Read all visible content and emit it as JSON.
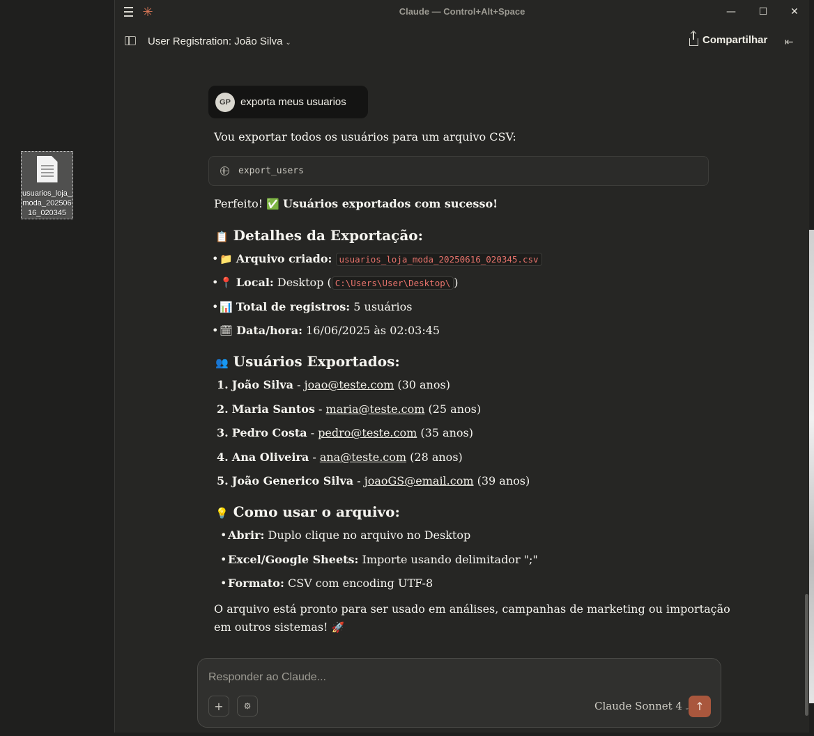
{
  "window": {
    "title": "Claude — Control+Alt+Space"
  },
  "desktop": {
    "file_name": "usuarios_loja_moda_20250616_020345"
  },
  "header": {
    "conversation_title": "User Registration: João Silva",
    "share_label": "Compartilhar"
  },
  "user_message": {
    "avatar_initials": "GP",
    "text": "exporta meus usuarios"
  },
  "assistant": {
    "intro": "Vou exportar todos os usuários para um arquivo CSV:",
    "tool_call": "export_users",
    "success_prefix": "Perfeito! ",
    "success_emoji": "✅",
    "success_text": "Usuários exportados com sucesso!",
    "details_heading": {
      "emoji": "📋",
      "text": "Detalhes da Exportação:"
    },
    "details": [
      {
        "emoji": "📁",
        "label": "Arquivo criado:",
        "code": "usuarios_loja_moda_20250616_020345.csv"
      },
      {
        "emoji": "📍",
        "label": "Local:",
        "text_before": " Desktop (",
        "code": "C:\\Users\\User\\Desktop\\",
        "text_after": ")"
      },
      {
        "emoji": "📊",
        "label": "Total de registros:",
        "text": " 5 usuários"
      },
      {
        "emoji": "🗓",
        "label": "Data/hora:",
        "text": " 16/06/2025 às 02:03:45"
      }
    ],
    "users_heading": {
      "emoji": "👥",
      "text": "Usuários Exportados:"
    },
    "users": [
      {
        "num": "1.",
        "name": "João Silva",
        "sep": " - ",
        "email": "joao@teste.com",
        "age": " (30 anos)"
      },
      {
        "num": "2.",
        "name": "Maria Santos",
        "sep": " - ",
        "email": "maria@teste.com",
        "age": " (25 anos)"
      },
      {
        "num": "3.",
        "name": "Pedro Costa",
        "sep": " - ",
        "email": "pedro@teste.com",
        "age": " (35 anos)"
      },
      {
        "num": "4.",
        "name": "Ana Oliveira",
        "sep": " - ",
        "email": "ana@teste.com",
        "age": " (28 anos)"
      },
      {
        "num": "5.",
        "name": "João Generico Silva",
        "sep": " - ",
        "email": "joaoGS@email.com",
        "age": " (39 anos)"
      }
    ],
    "usage_heading": {
      "emoji": "💡",
      "text": "Como usar o arquivo:"
    },
    "usage": [
      {
        "label": "Abrir:",
        "text": " Duplo clique no arquivo no Desktop"
      },
      {
        "label": "Excel/Google Sheets:",
        "text": " Importe usando delimitador \";\""
      },
      {
        "label": "Formato:",
        "text": " CSV com encoding UTF-8"
      }
    ],
    "closing_line1": "O arquivo está pronto para ser usado em análises, campanhas de marketing ou importação",
    "closing_line2": "em outros sistemas! ",
    "closing_emoji": "🚀"
  },
  "composer": {
    "placeholder": "Responder ao Claude...",
    "model": "Claude Sonnet 4"
  },
  "icons": {
    "menu": "☰",
    "logo": "✳",
    "minimize": "—",
    "maximize": "☐",
    "close": "✕",
    "chevron": "⌄",
    "collapse": "⇤",
    "plus": "+",
    "tools": "⚙",
    "send": "↑"
  },
  "colors": {
    "accent": "#d97757",
    "send": "#a9573d",
    "code": "#e8736c"
  }
}
